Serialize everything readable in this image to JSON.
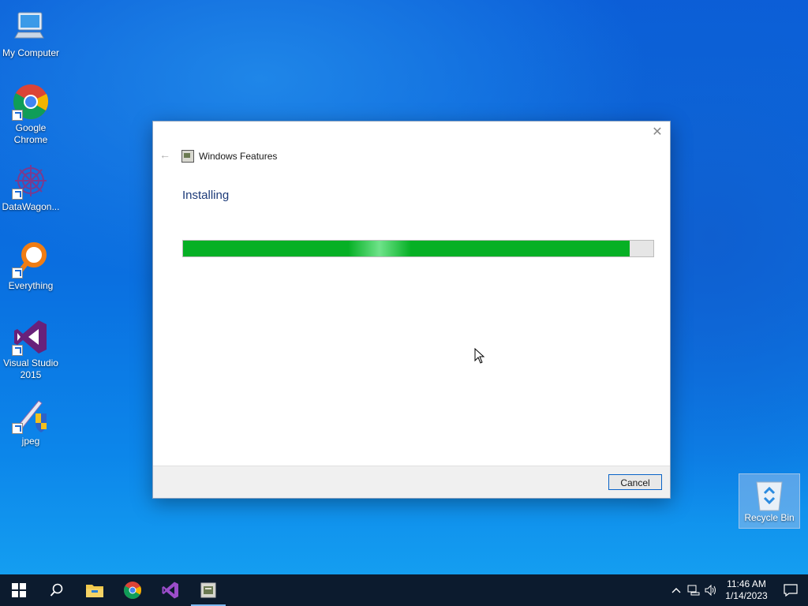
{
  "desktop": {
    "icons": [
      {
        "label": "My Computer"
      },
      {
        "label": "Google Chrome"
      },
      {
        "label": "DataWagon..."
      },
      {
        "label": "Everything"
      },
      {
        "label": "Visual Studio 2015"
      },
      {
        "label": "jpeg"
      }
    ],
    "recycle_bin": {
      "label": "Recycle Bin"
    }
  },
  "dialog": {
    "title": "Windows Features",
    "heading": "Installing",
    "progress_fraction": 0.95,
    "cancel_label": "Cancel",
    "close_glyph": "✕",
    "back_glyph": "←"
  },
  "taskbar": {
    "items": [
      "start-icon",
      "search-icon",
      "file-explorer-icon",
      "chrome-icon",
      "visual-studio-icon",
      "windows-features-icon"
    ],
    "active_item": "windows-features-icon",
    "clock": {
      "time": "11:46 AM",
      "date": "1/14/2023"
    }
  },
  "colors": {
    "progress": "#06b025",
    "accent": "#0a64c8",
    "heading": "#1c3a78",
    "taskbar": "#0c1b2e"
  }
}
